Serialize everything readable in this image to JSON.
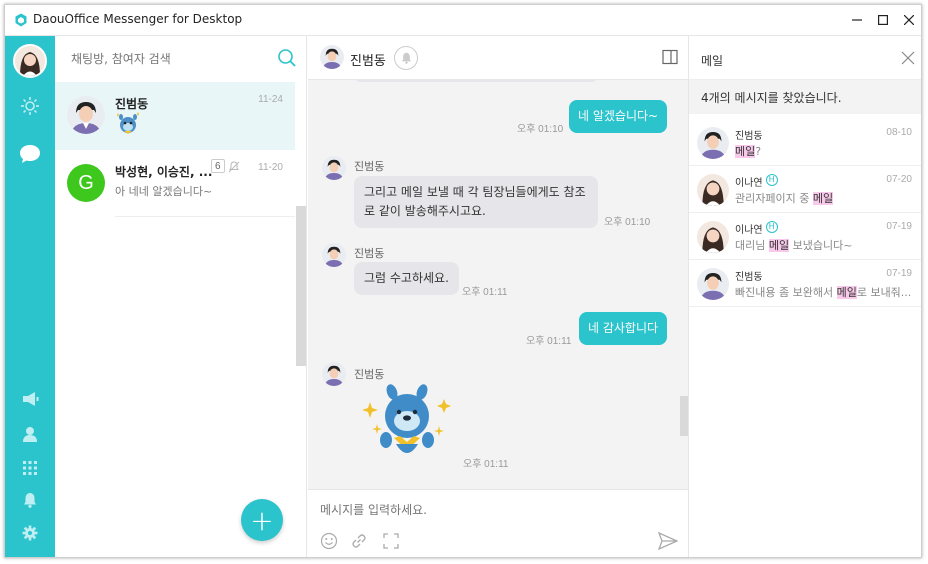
{
  "window": {
    "title": "DaouOffice Messenger for Desktop"
  },
  "window_controls": {
    "minimize": "—",
    "maximize": "□",
    "close": "✕"
  },
  "colors": {
    "accent": "#2bc3cc",
    "highlight": "#f8c9ea"
  },
  "sidebar": {
    "icons": [
      "profile-avatar",
      "status-icon",
      "chat-icon",
      "notice-icon",
      "contacts-icon",
      "apps-icon",
      "notification-icon",
      "settings-icon"
    ]
  },
  "room_list": {
    "search_placeholder": "채팅방, 참여자 검색",
    "rooms": [
      {
        "name": "진범동",
        "time": "11-24",
        "message": ""
      },
      {
        "name": "박성현, 이승진, ...",
        "count": "6",
        "time": "11-20",
        "message": "아 네네 알겠습니다~",
        "avatar_letter": "G"
      }
    ],
    "fab_label": "+"
  },
  "chat": {
    "header_name": "진범동",
    "messages": [
      {
        "type": "out",
        "text": "네 알겠습니다~",
        "time": "오후 01:10"
      },
      {
        "type": "in",
        "sender": "진범동",
        "text_line1": "그리고 메일 보낼 때 각 팀장님들에게도 참조",
        "text_line2": "로 같이 발송해주시고요.",
        "time": "오후 01:10"
      },
      {
        "type": "in",
        "sender": "진범동",
        "text": "그럼 수고하세요.",
        "time": "오후 01:11"
      },
      {
        "type": "out",
        "text": "네 감사합니다",
        "time": "오후 01:11"
      },
      {
        "type": "in-sticker",
        "sender": "진범동",
        "time": "오후 01:11"
      }
    ],
    "input_placeholder": "메시지를 입력하세요."
  },
  "search_panel": {
    "title": "메일",
    "summary": "4개의 메시지를 찾았습니다.",
    "results": [
      {
        "name": "진범동",
        "date": "08-10",
        "before": "",
        "match": "메일",
        "after": "?",
        "badge": ""
      },
      {
        "name": "이나연",
        "date": "07-20",
        "before": "관리자페이지 중 ",
        "match": "메일",
        "after": "",
        "badge": "H"
      },
      {
        "name": "이나연",
        "date": "07-19",
        "before": "대리님 ",
        "match": "메일",
        "after": " 보냈습니다~",
        "badge": "H"
      },
      {
        "name": "진범동",
        "date": "07-19",
        "before": "빠진내용 좀 보완해서 ",
        "match": "메일",
        "after": "로 보내줘...",
        "badge": ""
      }
    ]
  }
}
